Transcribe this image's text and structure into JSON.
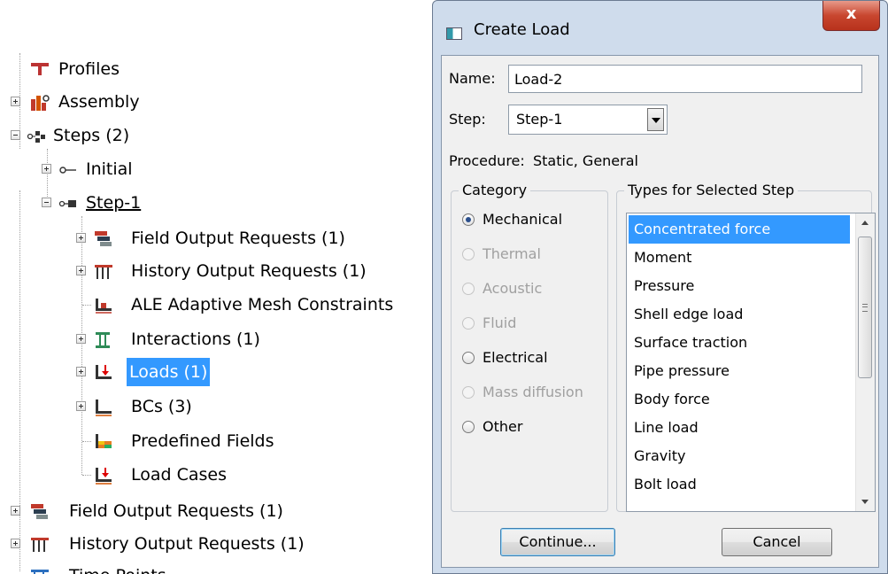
{
  "tree": {
    "nodes": [
      {
        "label": "Profiles",
        "icon": "profiles-icon"
      },
      {
        "label": "Assembly",
        "icon": "assembly-icon"
      },
      {
        "label": "Steps (2)",
        "icon": "steps-icon"
      },
      {
        "label": "Initial",
        "icon": "initial-step-icon"
      },
      {
        "label": "Step-1",
        "icon": "step-icon"
      },
      {
        "label": "Field Output Requests (1)",
        "icon": "field-output-icon"
      },
      {
        "label": "History Output Requests (1)",
        "icon": "history-output-icon"
      },
      {
        "label": "ALE Adaptive Mesh Constraints",
        "icon": "ale-mesh-icon"
      },
      {
        "label": "Interactions (1)",
        "icon": "interactions-icon"
      },
      {
        "label": "Loads (1)",
        "icon": "loads-icon"
      },
      {
        "label": "BCs (3)",
        "icon": "bcs-icon"
      },
      {
        "label": "Predefined Fields",
        "icon": "predefined-fields-icon"
      },
      {
        "label": "Load Cases",
        "icon": "load-cases-icon"
      },
      {
        "label": "Field Output Requests (1)",
        "icon": "field-output-icon"
      },
      {
        "label": "History Output Requests (1)",
        "icon": "history-output-icon"
      },
      {
        "label": "Time Points",
        "icon": "time-points-icon"
      }
    ]
  },
  "dialog": {
    "title": "Create Load",
    "close_label": "x",
    "name_label": "Name:",
    "name_value": "Load-2",
    "step_label": "Step:",
    "step_value": "Step-1",
    "procedure_label": "Procedure:",
    "procedure_value": "Static, General",
    "category_title": "Category",
    "categories": [
      {
        "label": "Mechanical",
        "checked": true,
        "enabled": true
      },
      {
        "label": "Thermal",
        "checked": false,
        "enabled": false
      },
      {
        "label": "Acoustic",
        "checked": false,
        "enabled": false
      },
      {
        "label": "Fluid",
        "checked": false,
        "enabled": false
      },
      {
        "label": "Electrical",
        "checked": false,
        "enabled": true
      },
      {
        "label": "Mass diffusion",
        "checked": false,
        "enabled": false
      },
      {
        "label": "Other",
        "checked": false,
        "enabled": true
      }
    ],
    "types_title": "Types for Selected Step",
    "types": [
      "Concentrated force",
      "Moment",
      "Pressure",
      "Shell edge load",
      "Surface traction",
      "Pipe pressure",
      "Body force",
      "Line load",
      "Gravity",
      "Bolt load"
    ],
    "selected_type": "Concentrated force",
    "continue_label": "Continue...",
    "cancel_label": "Cancel"
  },
  "colors": {
    "selection": "#3399ff",
    "dialog_frame": "#cfdcec",
    "close_button": "#c8462f"
  }
}
